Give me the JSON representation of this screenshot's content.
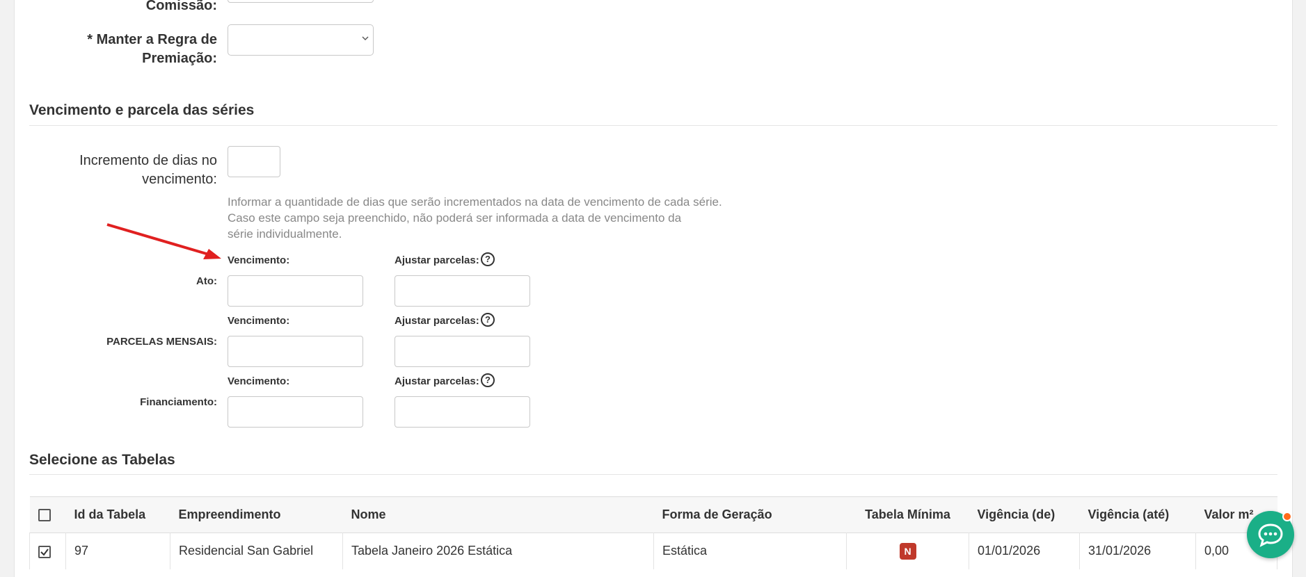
{
  "form": {
    "commission_label": "Comissão:",
    "keep_award_rule_label_line1": "* Manter a Regra de",
    "keep_award_rule_label_line2": "Premiação:",
    "keep_award_rule_value": ""
  },
  "due_section": {
    "title": "Vencimento e parcela das séries",
    "increment_label_line1": "Incremento de dias no",
    "increment_label_line2": "vencimento:",
    "increment_value": "",
    "help_line1": "Informar a quantidade de dias que serão incrementados na data de vencimento de cada série.",
    "help_line2": "Caso este campo seja preenchido, não poderá ser informada a data de vencimento da",
    "help_line3": "série individualmente.",
    "rows": [
      {
        "label": "Ato:",
        "due_label": "Vencimento:",
        "adjust_label": "Ajustar parcelas:",
        "due_value": "",
        "adjust_value": ""
      },
      {
        "label": "PARCELAS MENSAIS:",
        "due_label": "Vencimento:",
        "adjust_label": "Ajustar parcelas:",
        "due_value": "",
        "adjust_value": ""
      },
      {
        "label": "Financiamento:",
        "due_label": "Vencimento:",
        "adjust_label": "Ajustar parcelas:",
        "due_value": "",
        "adjust_value": ""
      }
    ],
    "help_icon_text": "?"
  },
  "tables_section": {
    "title": "Selecione as Tabelas",
    "columns": [
      "Id da Tabela",
      "Empreendimento",
      "Nome",
      "Forma de Geração",
      "Tabela Mínima",
      "Vigência (de)",
      "Vigência (até)",
      "Valor m²"
    ],
    "rows": [
      {
        "id": "97",
        "development": "Residencial San Gabriel",
        "name": "Tabela Janeiro 2026 Estática",
        "generation": "Estática",
        "min_table_badge": "N",
        "valid_from": "01/01/2026",
        "valid_to": "31/01/2026",
        "value_m2": "0,00",
        "checked": true
      }
    ]
  },
  "colors": {
    "accent_red": "#c0392b",
    "chat_green": "#1aaf87",
    "chat_dot": "#ff6a1a",
    "arrow": "#e02020"
  },
  "icons": {
    "chat": "chat-bubble-icon",
    "help": "question-circle-icon",
    "arrow": "red-pointer-arrow"
  }
}
